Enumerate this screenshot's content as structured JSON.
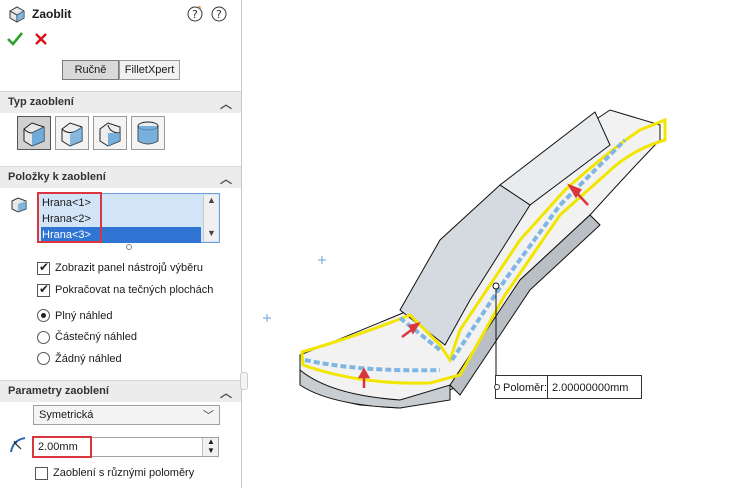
{
  "panel": {
    "title": "Zaoblit",
    "help_icons": [
      "question-star-icon",
      "help-icon"
    ],
    "ok_icon": "checkmark-icon",
    "cancel_icon": "close-icon",
    "tabs": [
      {
        "label": "Ručně",
        "active": true
      },
      {
        "label": "FilletXpert",
        "active": false
      }
    ]
  },
  "fillet_type": {
    "title": "Typ zaoblení",
    "options": [
      "constant-size-fillet-icon",
      "variable-size-fillet-icon",
      "face-fillet-icon",
      "full-round-fillet-icon"
    ],
    "selected_index": 0
  },
  "items": {
    "title": "Položky k zaoblení",
    "list": [
      {
        "label": "Hrana<1>",
        "selected": false
      },
      {
        "label": "Hrana<2>",
        "selected": false
      },
      {
        "label": "Hrana<3>",
        "selected": true
      }
    ],
    "checkboxes": [
      {
        "label": "Zobrazit panel nástrojů výběru",
        "checked": true
      },
      {
        "label": "Pokračovat na tečných plochách",
        "checked": true
      }
    ],
    "radios": [
      {
        "label": "Plný náhled",
        "checked": true
      },
      {
        "label": "Částečný náhled",
        "checked": false
      },
      {
        "label": "Žádný náhled",
        "checked": false
      }
    ]
  },
  "params": {
    "title": "Parametry zaoblení",
    "method": "Symetrická",
    "radius_value": "2.00mm",
    "multi_radius_label": "Zaoblení s různými poloměry",
    "multi_radius_checked": false
  },
  "viewport": {
    "callout_label": "Poloměr:",
    "callout_value": "2.00000000mm",
    "highlight_color": "#f2e600",
    "edge_preview_color": "#7fb6e3",
    "arrow_color": "#d9363e"
  }
}
